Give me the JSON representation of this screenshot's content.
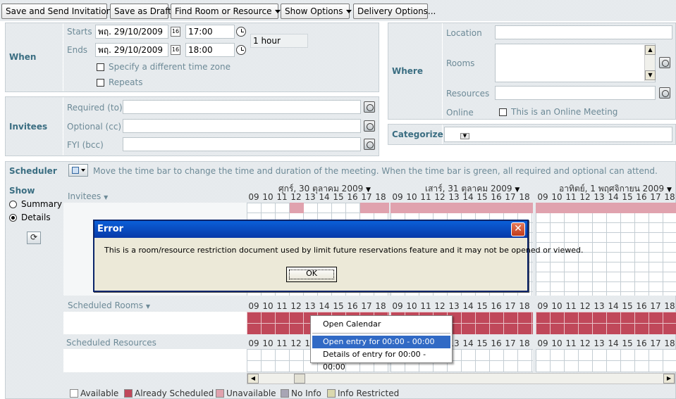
{
  "toolbar": {
    "save_send": "Save and Send Invitations",
    "save_draft": "Save as Draft",
    "find_room": "Find Room or Resource",
    "show_options": "Show Options",
    "delivery_options": "Delivery Options..."
  },
  "when": {
    "section_label": "When",
    "starts_label": "Starts",
    "ends_label": "Ends",
    "start_date": "พฤ. 29/10/2009",
    "start_time": "17:00",
    "end_date": "พฤ. 29/10/2009",
    "end_time": "18:00",
    "duration": "1 hour",
    "timezone_label": "Specify a different time zone",
    "repeats_label": "Repeats",
    "date_picker_glyph": "16"
  },
  "where": {
    "section_label": "Where",
    "location_label": "Location",
    "rooms_label": "Rooms",
    "resources_label": "Resources",
    "online_label": "Online",
    "online_meeting_label": "This is an Online Meeting"
  },
  "invitees": {
    "section_label": "Invitees",
    "required_label": "Required (to)",
    "optional_label": "Optional (cc)",
    "fyi_label": "FYI (bcc)"
  },
  "categorize": {
    "section_label": "Categorize"
  },
  "scheduler": {
    "section_label": "Scheduler",
    "hint": "Move the time bar to change the time and duration of the meeting.  When the time bar is green, all required and optional can attend.",
    "show_label": "Show",
    "summary_label": "Summary",
    "details_label": "Details",
    "invitees_header": "Invitees",
    "scheduled_rooms": "Scheduled Rooms",
    "scheduled_resources": "Scheduled Resources",
    "days": [
      "ศุกร์, 30 ตุลาคม 2009",
      "เสาร์, 31 ตุลาคม 2009",
      "อาทิตย์, 1 พฤศจิกายน 2009"
    ],
    "hours": [
      "09",
      "10",
      "11",
      "12",
      "13",
      "14",
      "15",
      "16",
      "17",
      "18"
    ]
  },
  "legend": {
    "available": "Available",
    "already_scheduled": "Already Scheduled",
    "unavailable": "Unavailable",
    "no_info": "No Info",
    "info_restricted": "Info Restricted"
  },
  "colors": {
    "already_scheduled": "#c0485a",
    "unavailable": "#e0a2ae",
    "no_info": "#a8a5b4",
    "info_restricted": "#dad8ae",
    "section_label": "#3b6e82"
  },
  "dialog": {
    "title": "Error",
    "message": "This is a room/resource restriction document  used by limit future reservations feature and it may not be opened or viewed.",
    "ok": "OK",
    "close_glyph": "✕"
  },
  "context_menu": {
    "items": [
      "Open Calendar",
      "Open entry for 00:00 - 00:00",
      "Details of entry for 00:00 - 00:00"
    ]
  }
}
